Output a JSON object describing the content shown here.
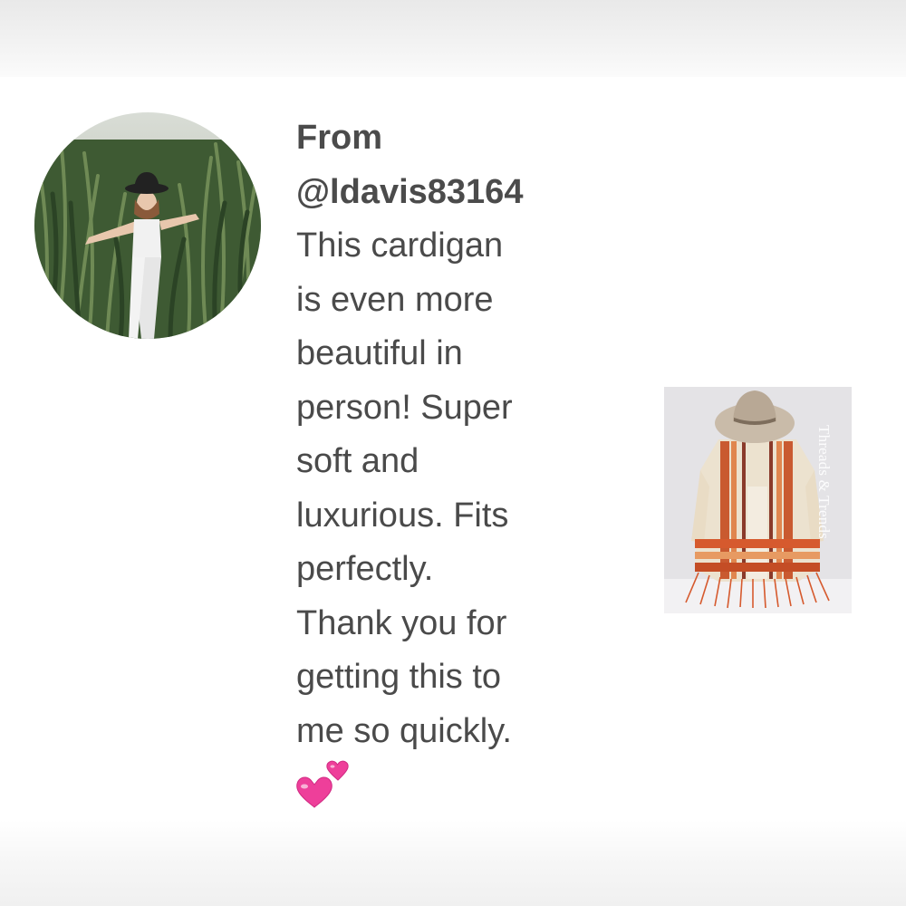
{
  "review": {
    "from_label": "From",
    "handle": "@ldavis83164",
    "body_lines": [
      "This cardigan",
      "is even more",
      "beautiful in",
      "person! Super",
      "soft and",
      "luxurious. Fits",
      "perfectly.",
      "Thank you for",
      "getting this to",
      "me so quickly."
    ],
    "emoji": "two-hearts-icon"
  },
  "avatar": {
    "subject": "woman in hat standing in tall grass field"
  },
  "product": {
    "subject": "cardigan with hat hanging on wall",
    "watermark": "Threads & Trends"
  },
  "colors": {
    "text": "#4a4a4a",
    "heart": "#ee3f9a",
    "cardigan_accent": "#d65a2e"
  }
}
